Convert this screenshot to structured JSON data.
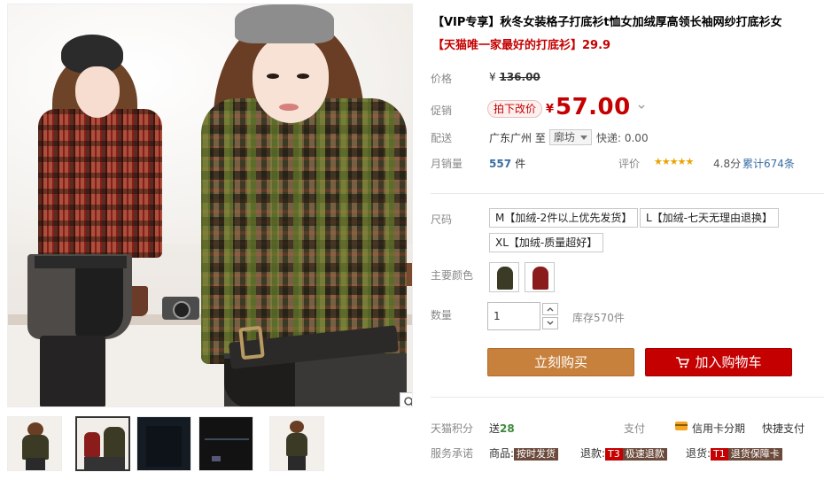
{
  "product": {
    "title": "【VIP专享】秋冬女装格子打底衫t恤女加绒厚高领长袖网纱打底衫女",
    "subtitle": "【天猫唯一家最好的打底衫】29.9"
  },
  "price": {
    "label": "价格",
    "currency": "¥",
    "original": "136.00"
  },
  "promo": {
    "label": "促销",
    "badge": "拍下改价",
    "currency": "¥",
    "price": "57.00"
  },
  "shipping": {
    "label": "配送",
    "from": "广东广州",
    "to_word": "至",
    "destination": "廓坊",
    "fee": "快递: 0.00"
  },
  "sales": {
    "label": "月销量",
    "value": "557",
    "unit": "件",
    "review_label": "评价",
    "stars": "★★★★★",
    "rating": "4.8分",
    "review_count": "累计674条"
  },
  "size": {
    "label": "尺码",
    "options": [
      "M【加绒-2件以上优先发货】",
      "L【加绒-七天无理由退换】",
      "XL【加绒-质量超好】"
    ]
  },
  "colors": {
    "label": "主要颜色",
    "swatches": [
      {
        "name": "green-plaid",
        "color": "#3b3a25"
      },
      {
        "name": "red-plaid",
        "color": "#8a1c1c"
      }
    ]
  },
  "quantity": {
    "label": "数量",
    "value": "1",
    "stock": "库存570件"
  },
  "actions": {
    "buy_now": "立刻购买",
    "add_to_cart": "加入购物车"
  },
  "points": {
    "label": "天猫积分",
    "prefix": "送",
    "value": "28"
  },
  "payment": {
    "label": "支付",
    "credit": "信用卡分期",
    "quick": "快捷支付"
  },
  "service": {
    "label": "服务承诺",
    "goods_prefix": "商品:",
    "goods_tag": "按时发货",
    "refund_prefix": "退款:",
    "refund_code": "T3",
    "refund_tag": "极速退款",
    "return_prefix": "退货:",
    "return_code": "T1",
    "return_tag": "退货保障卡"
  },
  "colors_theme": {
    "accent_red": "#c40000",
    "buy_orange": "#c8813c",
    "link_blue": "#3a6ea5",
    "star_gold": "#e8a400"
  },
  "icons": [
    "zoom-icon",
    "chevron-down-icon",
    "cart-icon",
    "credit-card-icon",
    "arrow-up-icon",
    "arrow-down-icon"
  ]
}
